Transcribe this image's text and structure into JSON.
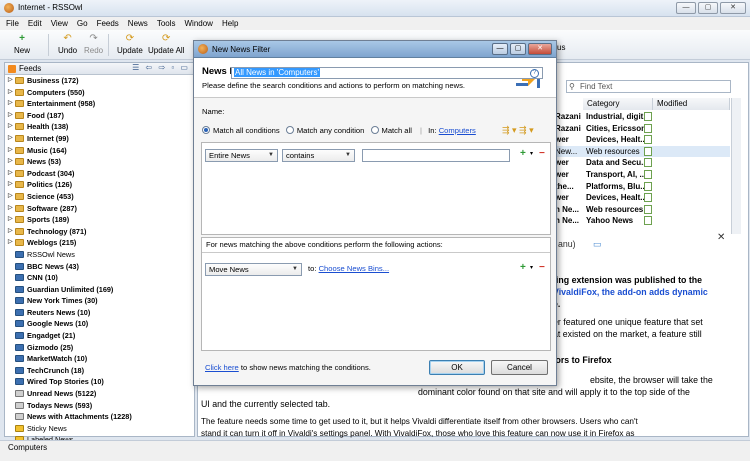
{
  "window": {
    "title": "Internet - RSSOwl",
    "controls": [
      "—",
      "▢",
      "✕"
    ]
  },
  "menu": [
    "File",
    "Edit",
    "View",
    "Go",
    "Feeds",
    "News",
    "Tools",
    "Window",
    "Help"
  ],
  "toolbar": [
    {
      "label": "New",
      "icon": "+",
      "enabled": true
    },
    {
      "label": "Undo",
      "icon": "↶",
      "enabled": true
    },
    {
      "label": "Redo",
      "icon": "↷",
      "enabled": false
    },
    {
      "label": "Update",
      "icon": "⟳",
      "enabled": true
    },
    {
      "label": "Update All",
      "icon": "⟳",
      "enabled": true
    }
  ],
  "toolbar_partial": "us",
  "feeds": {
    "title": "Feeds",
    "items": [
      {
        "label": "Business (172)",
        "kind": "folder",
        "bold": true,
        "expandable": true
      },
      {
        "label": "Computers (550)",
        "kind": "folder",
        "bold": true,
        "expandable": true
      },
      {
        "label": "Entertainment (958)",
        "kind": "folder",
        "bold": true,
        "expandable": true
      },
      {
        "label": "Food (187)",
        "kind": "folder",
        "bold": true,
        "expandable": true
      },
      {
        "label": "Health (138)",
        "kind": "folder",
        "bold": true,
        "expandable": true
      },
      {
        "label": "Internet (99)",
        "kind": "folder",
        "bold": true,
        "expandable": true
      },
      {
        "label": "Music (164)",
        "kind": "folder",
        "bold": true,
        "expandable": true
      },
      {
        "label": "News (53)",
        "kind": "folder",
        "bold": true,
        "expandable": true
      },
      {
        "label": "Podcast (304)",
        "kind": "folder",
        "bold": true,
        "expandable": true
      },
      {
        "label": "Politics (126)",
        "kind": "folder",
        "bold": true,
        "expandable": true
      },
      {
        "label": "Science (453)",
        "kind": "folder",
        "bold": true,
        "expandable": true
      },
      {
        "label": "Software (287)",
        "kind": "folder",
        "bold": true,
        "expandable": true
      },
      {
        "label": "Sports (189)",
        "kind": "folder",
        "bold": true,
        "expandable": true
      },
      {
        "label": "Technology (871)",
        "kind": "folder",
        "bold": true,
        "expandable": true
      },
      {
        "label": "Weblogs (215)",
        "kind": "folder",
        "bold": true,
        "expandable": true
      },
      {
        "label": "RSSOwl News",
        "kind": "feed",
        "bold": false,
        "expandable": false
      },
      {
        "label": "BBC News (43)",
        "kind": "feed",
        "bold": true,
        "expandable": false
      },
      {
        "label": "CNN (10)",
        "kind": "feed",
        "bold": true,
        "expandable": false
      },
      {
        "label": "Guardian Unlimited (169)",
        "kind": "feed",
        "bold": true,
        "expandable": false
      },
      {
        "label": "New York Times (30)",
        "kind": "feed",
        "bold": true,
        "expandable": false
      },
      {
        "label": "Reuters News (10)",
        "kind": "feed",
        "bold": true,
        "expandable": false
      },
      {
        "label": "Google News (10)",
        "kind": "feed",
        "bold": true,
        "expandable": false
      },
      {
        "label": "Engadget (21)",
        "kind": "feed",
        "bold": true,
        "expandable": false
      },
      {
        "label": "Gizmodo (25)",
        "kind": "feed",
        "bold": true,
        "expandable": false
      },
      {
        "label": "MarketWatch (10)",
        "kind": "feed",
        "bold": true,
        "expandable": false
      },
      {
        "label": "TechCrunch (18)",
        "kind": "feed",
        "bold": true,
        "expandable": false
      },
      {
        "label": "Wired Top Stories (10)",
        "kind": "feed",
        "bold": true,
        "expandable": false
      },
      {
        "label": "Unread News (5122)",
        "kind": "bin",
        "bold": true,
        "expandable": false
      },
      {
        "label": "Todays News (593)",
        "kind": "bin",
        "bold": true,
        "expandable": false
      },
      {
        "label": "News with Attachments (1228)",
        "kind": "bin",
        "bold": true,
        "expandable": false
      },
      {
        "label": "Sticky News",
        "kind": "star",
        "bold": false,
        "expandable": false
      },
      {
        "label": "Labeled News",
        "kind": "star",
        "bold": false,
        "expandable": false
      }
    ]
  },
  "search": {
    "placeholder": "Find Text"
  },
  "news_table": {
    "headers": [
      "Category",
      "Modified"
    ],
    "rows": [
      {
        "author": "Razani",
        "category": "Industrial, digit...",
        "bold": true
      },
      {
        "author": "Razani",
        "category": "Cities, Ericsson...",
        "bold": true
      },
      {
        "author": "wer",
        "category": "Devices, Healt...",
        "bold": true
      },
      {
        "author": "New...",
        "category": "Web resources",
        "bold": false
      },
      {
        "author": "wer",
        "category": "Data and Secu...",
        "bold": true
      },
      {
        "author": "wer",
        "category": "Transport, AI, ...",
        "bold": true
      },
      {
        "author": "the...",
        "category": "Platforms, Blu...",
        "bold": true
      },
      {
        "author": "wer",
        "category": "Devices, Healt...",
        "bold": true
      },
      {
        "author": "n Ne...",
        "category": "Web resources",
        "bold": true
      },
      {
        "author": "n Ne...",
        "category": "Yahoo News",
        "bold": true
      }
    ]
  },
  "article": {
    "author_fragment": "anu)",
    "headline": [
      "ting extension was published to the",
      "VivaldiFox, the add-on adds dynamic",
      "e."
    ],
    "para1": [
      "er featured one unique feature that set",
      "at existed on the market, a feature still"
    ],
    "subhead": "lors to Firefox",
    "para2": [
      "ebsite, the browser will take the",
      "dominant color found on that site and will apply it to the top side of the",
      "UI and the currently selected tab."
    ],
    "para3": [
      "The feature needs some time to get used to it, but it helps Vivaldi differentiate itself from other browsers. Users who can't",
      "stand it can turn it off in Vivaldi's settings panel. With VivaldiFox, those who love this feature can now use it in Firefox as"
    ]
  },
  "status": "Computers",
  "dialog": {
    "title": "New News Filter",
    "heading": "News Filter",
    "subheading": "Please define the search conditions and actions to perform on matching news.",
    "name_label": "Name:",
    "name_value": "All News in 'Computers'",
    "help": "?",
    "match_options": [
      "Match all conditions",
      "Match any condition",
      "Match all"
    ],
    "match_selected": 0,
    "in_label": "In:",
    "in_value": "Computers",
    "condition": {
      "field": "Entire News",
      "operator": "contains",
      "value": ""
    },
    "actions_label": "For news matching the above conditions perform the following actions:",
    "action": {
      "type": "Move News",
      "to_label": "to:",
      "target": "Choose News Bins..."
    },
    "footer_link": "Click here",
    "footer_text": " to show news matching the conditions.",
    "ok": "OK",
    "cancel": "Cancel",
    "colors": {
      "accent": "#1a4ed1",
      "add": "#2e9a35",
      "remove": "#d2352a"
    }
  }
}
